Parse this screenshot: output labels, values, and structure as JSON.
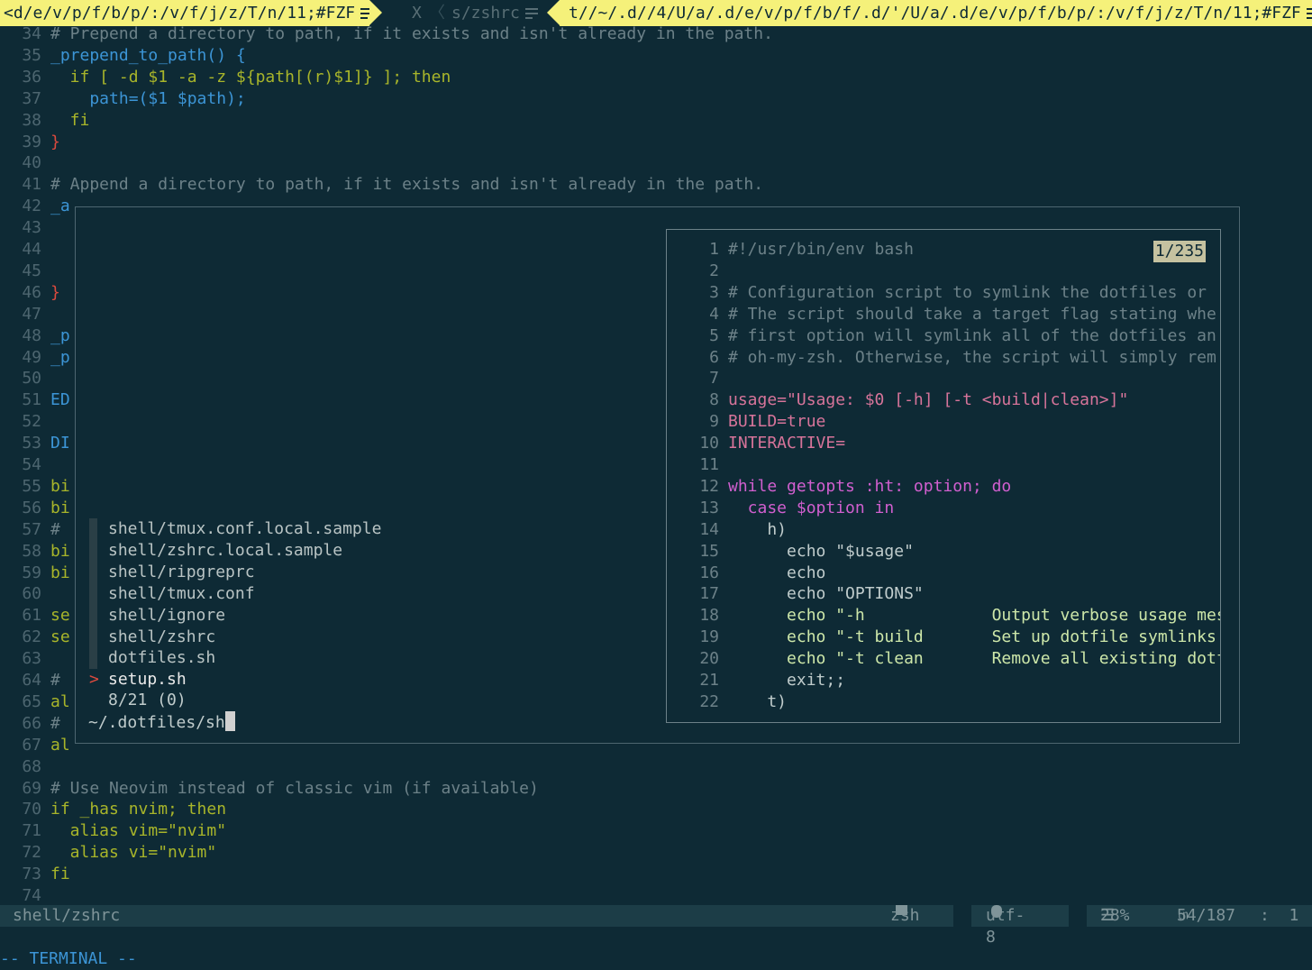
{
  "tabline": {
    "tab1": "<d/e/v/p/f/b/p/:/v/f/j/z/T/n/11;#FZF",
    "close": "X",
    "tab2": "s/zshrc",
    "tab3": "t//~/.d//4/U/a/.d/e/v/p/f/b/f/.d/'/U/a/.d/e/v/p/f/b/p/:/v/f/j/z/T/n/11;#FZF"
  },
  "editor": {
    "lines": [
      {
        "n": "34",
        "t": "# Prepend a directory to path, if it exists and isn't already in the path."
      },
      {
        "n": "35",
        "t": "_prepend_to_path() {"
      },
      {
        "n": "36",
        "t": "  if [ -d $1 -a -z ${path[(r)$1]} ]; then"
      },
      {
        "n": "37",
        "t": "    path=($1 $path);"
      },
      {
        "n": "38",
        "t": "  fi"
      },
      {
        "n": "39",
        "t": "}"
      },
      {
        "n": "40",
        "t": ""
      },
      {
        "n": "41",
        "t": "# Append a directory to path, if it exists and isn't already in the path."
      },
      {
        "n": "42",
        "t": "_a"
      },
      {
        "n": "43",
        "t": ""
      },
      {
        "n": "44",
        "t": ""
      },
      {
        "n": "45",
        "t": ""
      },
      {
        "n": "46",
        "t": "}"
      },
      {
        "n": "47",
        "t": ""
      },
      {
        "n": "48",
        "t": "_p"
      },
      {
        "n": "49",
        "t": "_p"
      },
      {
        "n": "50",
        "t": ""
      },
      {
        "n": "51",
        "t": "ED"
      },
      {
        "n": "52",
        "t": ""
      },
      {
        "n": "53",
        "t": "DI"
      },
      {
        "n": "54",
        "t": ""
      },
      {
        "n": "55",
        "t": "bi"
      },
      {
        "n": "56",
        "t": "bi"
      },
      {
        "n": "57",
        "t": "#"
      },
      {
        "n": "58",
        "t": "bi"
      },
      {
        "n": "59",
        "t": "bi"
      },
      {
        "n": "60",
        "t": ""
      },
      {
        "n": "61",
        "t": "se"
      },
      {
        "n": "62",
        "t": "se"
      },
      {
        "n": "63",
        "t": ""
      },
      {
        "n": "64",
        "t": "#"
      },
      {
        "n": "65",
        "t": "al"
      },
      {
        "n": "66",
        "t": "#"
      },
      {
        "n": "67",
        "t": "al"
      },
      {
        "n": "68",
        "t": ""
      },
      {
        "n": "69",
        "t": "# Use Neovim instead of classic vim (if available)"
      },
      {
        "n": "70",
        "t": "if _has nvim; then"
      },
      {
        "n": "71",
        "t": "  alias vim=\"nvim\""
      },
      {
        "n": "72",
        "t": "  alias vi=\"nvim\""
      },
      {
        "n": "73",
        "t": "fi"
      },
      {
        "n": "74",
        "t": ""
      }
    ]
  },
  "fzf": {
    "items": [
      "shell/tmux.conf.local.sample",
      "shell/zshrc.local.sample",
      "shell/ripgreprc",
      "shell/tmux.conf",
      "shell/ignore",
      "shell/zshrc",
      "dotfiles.sh",
      "setup.sh"
    ],
    "pointer": ">",
    "info": "8/21 (0)",
    "prompt": "~/.dotfiles/sh",
    "preview": {
      "position": "1/235",
      "lines": [
        {
          "n": "1",
          "t": "#!/usr/bin/env bash"
        },
        {
          "n": "2",
          "t": ""
        },
        {
          "n": "3",
          "t": "# Configuration script to symlink the dotfiles or"
        },
        {
          "n": "4",
          "t": "# The script should take a target flag stating whe"
        },
        {
          "n": "5",
          "t": "# first option will symlink all of the dotfiles an"
        },
        {
          "n": "6",
          "t": "# oh-my-zsh. Otherwise, the script will simply rem"
        },
        {
          "n": "7",
          "t": ""
        },
        {
          "n": "8",
          "t": "usage=\"Usage: $0 [-h] [-t <build|clean>]\""
        },
        {
          "n": "9",
          "t": "BUILD=true"
        },
        {
          "n": "10",
          "t": "INTERACTIVE="
        },
        {
          "n": "11",
          "t": ""
        },
        {
          "n": "12",
          "t": "while getopts :ht: option; do"
        },
        {
          "n": "13",
          "t": "  case $option in"
        },
        {
          "n": "14",
          "t": "    h)"
        },
        {
          "n": "15",
          "t": "      echo \"$usage\""
        },
        {
          "n": "16",
          "t": "      echo"
        },
        {
          "n": "17",
          "t": "      echo \"OPTIONS\""
        },
        {
          "n": "18",
          "t": "      echo \"-h             Output verbose usage mes"
        },
        {
          "n": "19",
          "t": "      echo \"-t build       Set up dotfile symlinks"
        },
        {
          "n": "20",
          "t": "      echo \"-t clean       Remove all existing dotf"
        },
        {
          "n": "21",
          "t": "      exit;;"
        },
        {
          "n": "22",
          "t": "    t)"
        }
      ]
    }
  },
  "statusline": {
    "file": "shell/zshrc",
    "filetype": "zsh",
    "encoding": "utf-8",
    "percent": "28%",
    "position": "54/187",
    "col": ":  1"
  },
  "mode": "-- TERMINAL --",
  "colors": {
    "background": "#0e2a35",
    "tab_active": "#f5f17a",
    "comment": "#6c8188",
    "keyword": "#a8b52a",
    "function": "#3c95d6",
    "red": "#dc4a3e"
  }
}
